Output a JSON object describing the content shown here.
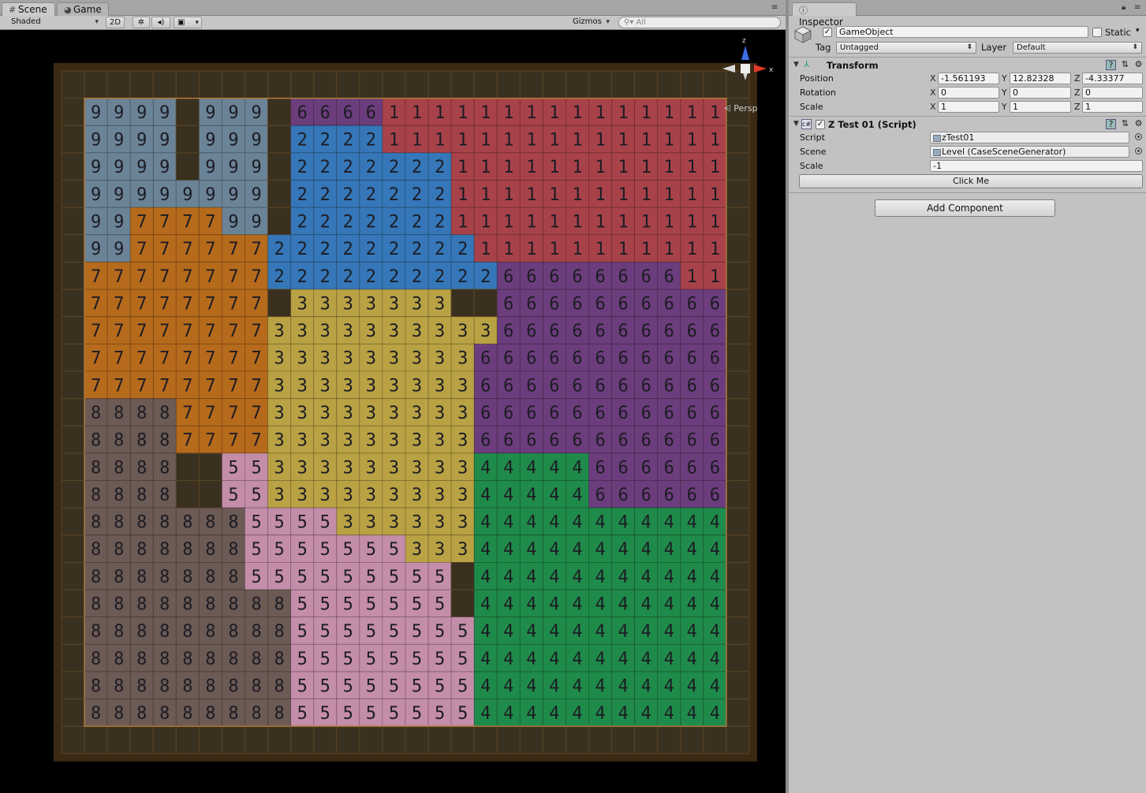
{
  "scene_tabs": [
    {
      "label": "Scene",
      "icon": "hash-icon"
    },
    {
      "label": "Game",
      "icon": "pacman-icon"
    }
  ],
  "toolbar": {
    "shading_mode": "Shaded",
    "mode_2d": "2D",
    "gizmos": "Gizmos",
    "search_placeholder": "All"
  },
  "view_gizmo": {
    "z_label": "z",
    "x_label": "x",
    "projection": "Persp"
  },
  "level": {
    "floor_colors": {
      "9": "#6b8396",
      "2": "#3577b8",
      "1": "#a8424a",
      "6": "#6c3d7c",
      "7": "#b66a1c",
      "3": "#b9a244",
      "8": "#6c5a55",
      "5": "#c48daa",
      "4": "#1f8b4a",
      "0": "#3a3020"
    },
    "digit_color": "#1c1c24",
    "wall_color": "#3a2a14",
    "grid": [
      "000000000000000000000000000000",
      "099990999066661111111111111110",
      "099990999022221111111111111110",
      "099990999022222221111111111110",
      "099999999022222221111111111110",
      "099777799022222221111111111110",
      "099777777222222222111111111110",
      "077777777222222222266666666110",
      "077777777033333330066666666660",
      "077777777333333333366666666660",
      "077777777333333333666666666660",
      "077777777333333333666666666660",
      "088887777333333333666666666660",
      "088887777333333333666666666660",
      "088880055333333333444446666660",
      "088880055333333333444446666660",
      "088888885555333333444444444440",
      "088888885555555333444444444440",
      "088888885555555550444444444440",
      "088888888855555550444444444440",
      "088888888855555555444444444440",
      "088888888855555555444444444440",
      "088888888855555555444444444440",
      "088888888855555555444444444440",
      "000000000000000000000000000000"
    ]
  },
  "inspector": {
    "tab_label": "Inspector",
    "object_name": "GameObject",
    "static_label": "Static",
    "tag_label": "Tag",
    "tag_value": "Untagged",
    "layer_label": "Layer",
    "layer_value": "Default",
    "transform": {
      "title": "Transform",
      "position_label": "Position",
      "rotation_label": "Rotation",
      "scale_label": "Scale",
      "position": {
        "x": "-1.561193",
        "y": "12.82328",
        "z": "-4.33377"
      },
      "rotation": {
        "x": "0",
        "y": "0",
        "z": "0"
      },
      "scale": {
        "x": "1",
        "y": "1",
        "z": "1"
      },
      "axis_x": "X",
      "axis_y": "Y",
      "axis_z": "Z"
    },
    "script_component": {
      "title": "Z Test 01 (Script)",
      "script_label": "Script",
      "script_value": "zTest01",
      "scene_label": "Scene",
      "scene_value": "Level (CaseSceneGenerator)",
      "scale_label": "Scale",
      "scale_value": "-1",
      "button_label": "Click Me"
    },
    "add_component_label": "Add Component"
  }
}
